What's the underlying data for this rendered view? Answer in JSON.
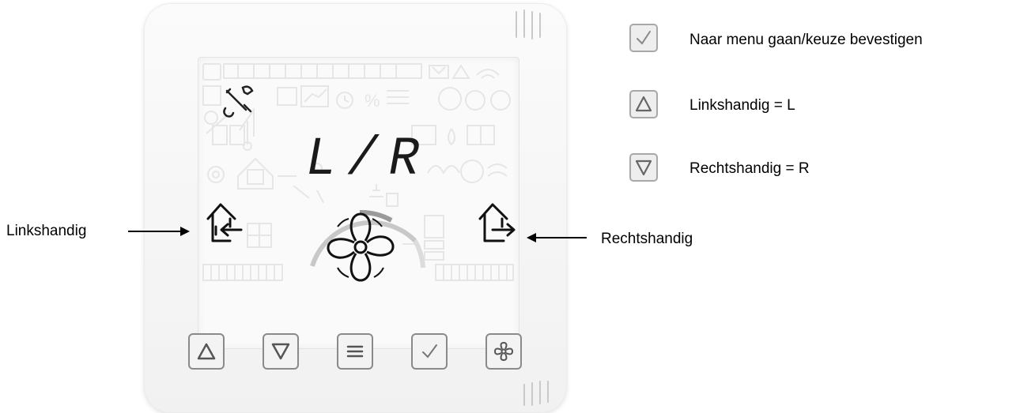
{
  "display": {
    "mode_text": "L/R"
  },
  "callouts": {
    "left_label": "Linkshandig",
    "right_label": "Rechtshandig"
  },
  "legend": [
    {
      "icon": "check-icon",
      "text": "Naar menu gaan/keuze bevestigen"
    },
    {
      "icon": "triangle-up-icon",
      "text": "Linkshandig = L"
    },
    {
      "icon": "triangle-down-icon",
      "text": "Rechtshandig = R"
    }
  ],
  "buttons": [
    {
      "icon": "triangle-up-icon"
    },
    {
      "icon": "triangle-down-icon"
    },
    {
      "icon": "menu-icon"
    },
    {
      "icon": "check-icon"
    },
    {
      "icon": "fan-icon"
    }
  ]
}
